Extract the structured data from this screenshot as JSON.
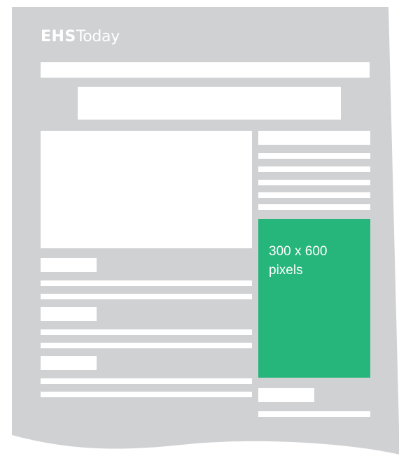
{
  "logo": {
    "part1": "EHS",
    "part2": "Today"
  },
  "ad": {
    "line1": "300 x 600",
    "line2": "pixels"
  },
  "colors": {
    "paper": "#d0d1d3",
    "placeholder": "#ffffff",
    "ad_fill": "#26b57a",
    "ad_text": "#ffffff",
    "background": "#ffffff"
  }
}
